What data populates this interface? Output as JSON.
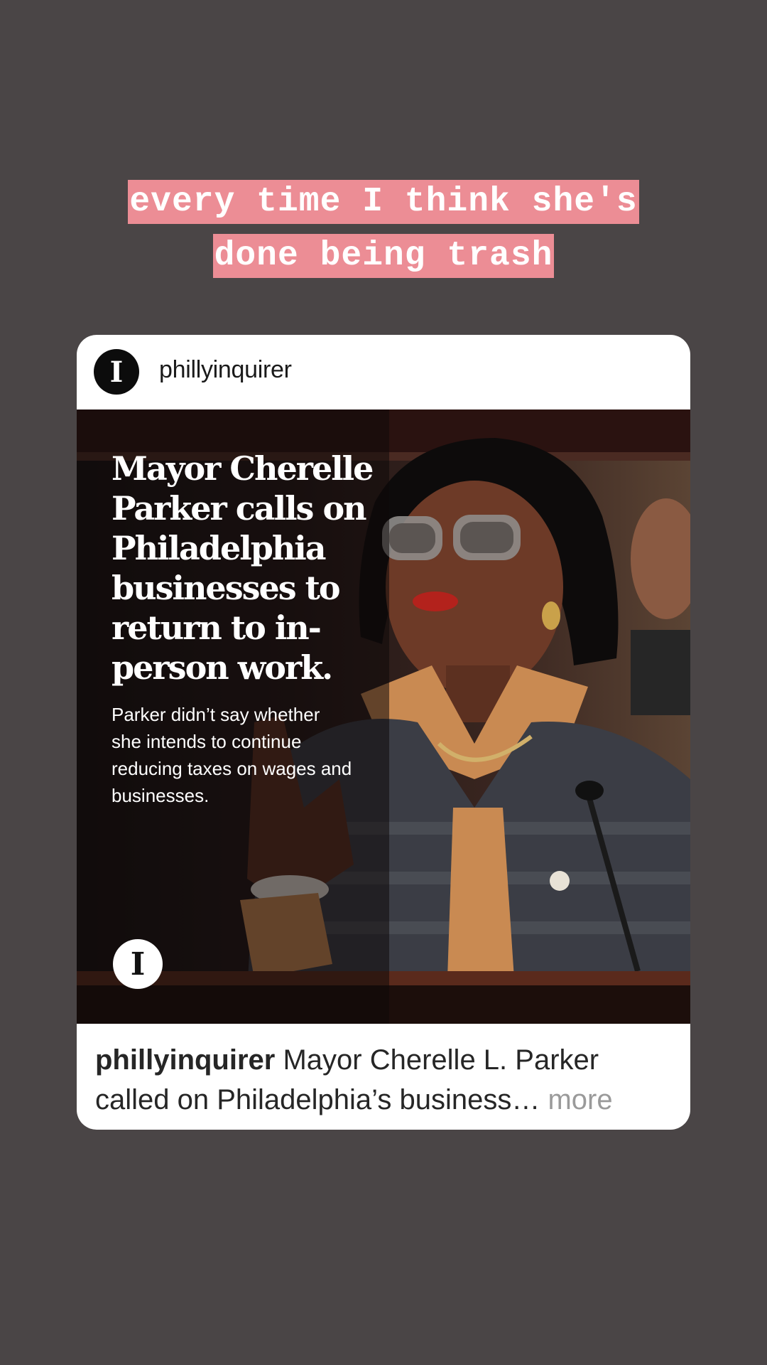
{
  "story": {
    "caption_line1": "every time I think she's",
    "caption_line2": "done being trash"
  },
  "post": {
    "avatar_letter": "I",
    "username": "phillyinquirer",
    "image": {
      "headline": "Mayor Cherelle Parker calls on Philadelphia businesses to return to in-person work.",
      "subhead": "Parker didn’t say whether she intends to continue reducing taxes on wages and businesses.",
      "logo_letter": "I"
    },
    "caption": {
      "username": "phillyinquirer",
      "text": " Mayor Cherelle L. Parker called on Philadelphia’s business",
      "ellipsis": "…",
      "more_label": " more"
    }
  },
  "colors": {
    "background": "#4a4546",
    "caption_highlight": "#ec8d95",
    "more_text": "#9a9a9a"
  }
}
